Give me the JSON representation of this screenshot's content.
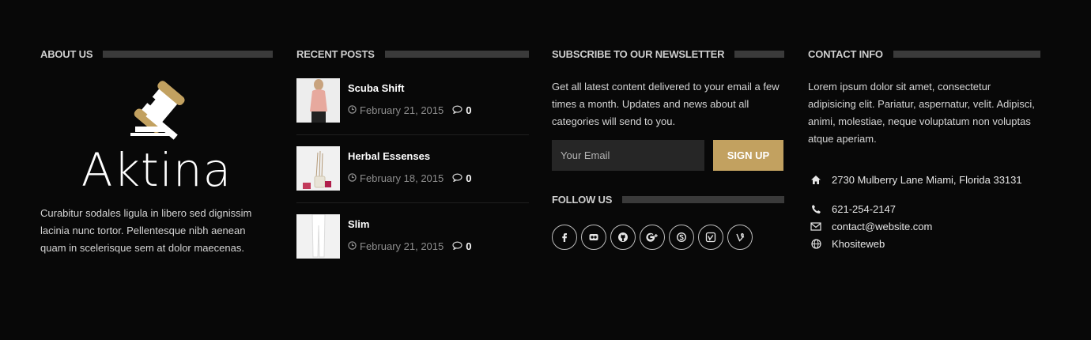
{
  "about": {
    "title": "ABOUT US",
    "logo_word": "Aktina",
    "text": "Curabitur sodales ligula in libero sed dignissim lacinia nunc tortor. Pellentesque nibh aenean quam in scelerisque sem at dolor maecenas."
  },
  "recent_posts": {
    "title": "RECENT POSTS",
    "items": [
      {
        "title": "Scuba Shift",
        "date": "February 21, 2015",
        "comments": "0"
      },
      {
        "title": "Herbal Essenses",
        "date": "February 18, 2015",
        "comments": "0"
      },
      {
        "title": "Slim",
        "date": "February 21, 2015",
        "comments": "0"
      }
    ]
  },
  "newsletter": {
    "title": "SUBSCRIBE TO OUR NEWSLETTER",
    "text": "Get all latest content delivered to your email a few times a month. Updates and news about all categories will send to you.",
    "email_placeholder": "Your Email",
    "button_label": "SIGN UP",
    "follow_title": "FOLLOW US",
    "social_icons": [
      "facebook-icon",
      "flickr-icon",
      "github-icon",
      "google-plus-icon",
      "skype-icon",
      "vimeo-icon",
      "vine-icon"
    ]
  },
  "contact": {
    "title": "CONTACT INFO",
    "text": "Lorem ipsum dolor sit amet, consectetur adipisicing elit. Pariatur, aspernatur, velit. Adipisci, animi, molestiae, neque voluptatum non voluptas atque aperiam.",
    "address": "2730 Mulberry Lane Miami, Florida 33131",
    "phone": "621-254-2147",
    "email": "contact@website.com",
    "website": "Khositeweb"
  },
  "colors": {
    "background": "#080808",
    "accent": "#c2a160",
    "title_bar": "#3a3a3a"
  }
}
